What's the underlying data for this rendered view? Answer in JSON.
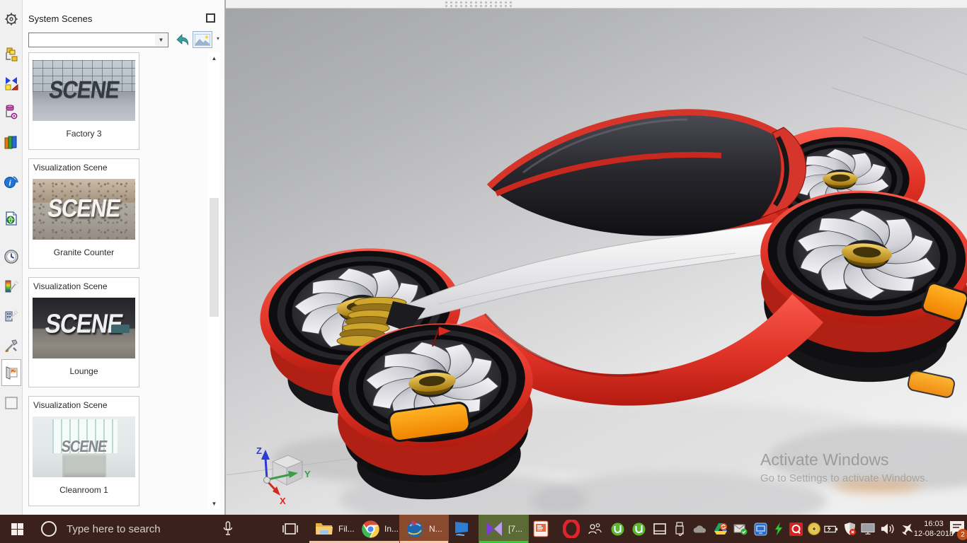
{
  "panel": {
    "title": "System Scenes",
    "combo_value": "",
    "scenes": [
      {
        "header": "",
        "label": "Factory 3",
        "scene_text": "SCENE"
      },
      {
        "header": "Visualization Scene",
        "label": "Granite Counter",
        "scene_text": "SCENE"
      },
      {
        "header": "Visualization Scene",
        "label": "Lounge",
        "scene_text": "SCENE"
      },
      {
        "header": "Visualization Scene",
        "label": "Cleanroom 1",
        "scene_text": "SCENE"
      }
    ],
    "scroll_up_glyph": "▲",
    "scroll_down_glyph": "▼",
    "combo_arrow_glyph": "▼",
    "img_caret_glyph": "▼"
  },
  "viewport": {
    "watermark": {
      "line1": "Activate Windows",
      "line2": "Go to Settings to activate Windows."
    },
    "triad": {
      "x": "X",
      "y": "Y",
      "z": "Z"
    }
  },
  "taskbar": {
    "search_placeholder": "Type here to search",
    "apps": {
      "file_explorer_label": "Fil...",
      "chrome_label": "In...",
      "nx_label": "N...",
      "kmplayer_label": "[7..."
    },
    "clock": {
      "time": "16:03",
      "date": "12-08-2018"
    },
    "notification_badge": "2"
  },
  "colors": {
    "accent_red": "#d6352c",
    "orange_indicator": "#ff9400",
    "gold": "#d3a322",
    "taskbar_bg": "#3a211b",
    "kmplayer_underline": "#35cc35",
    "app_underline": "#f3c6a5"
  }
}
